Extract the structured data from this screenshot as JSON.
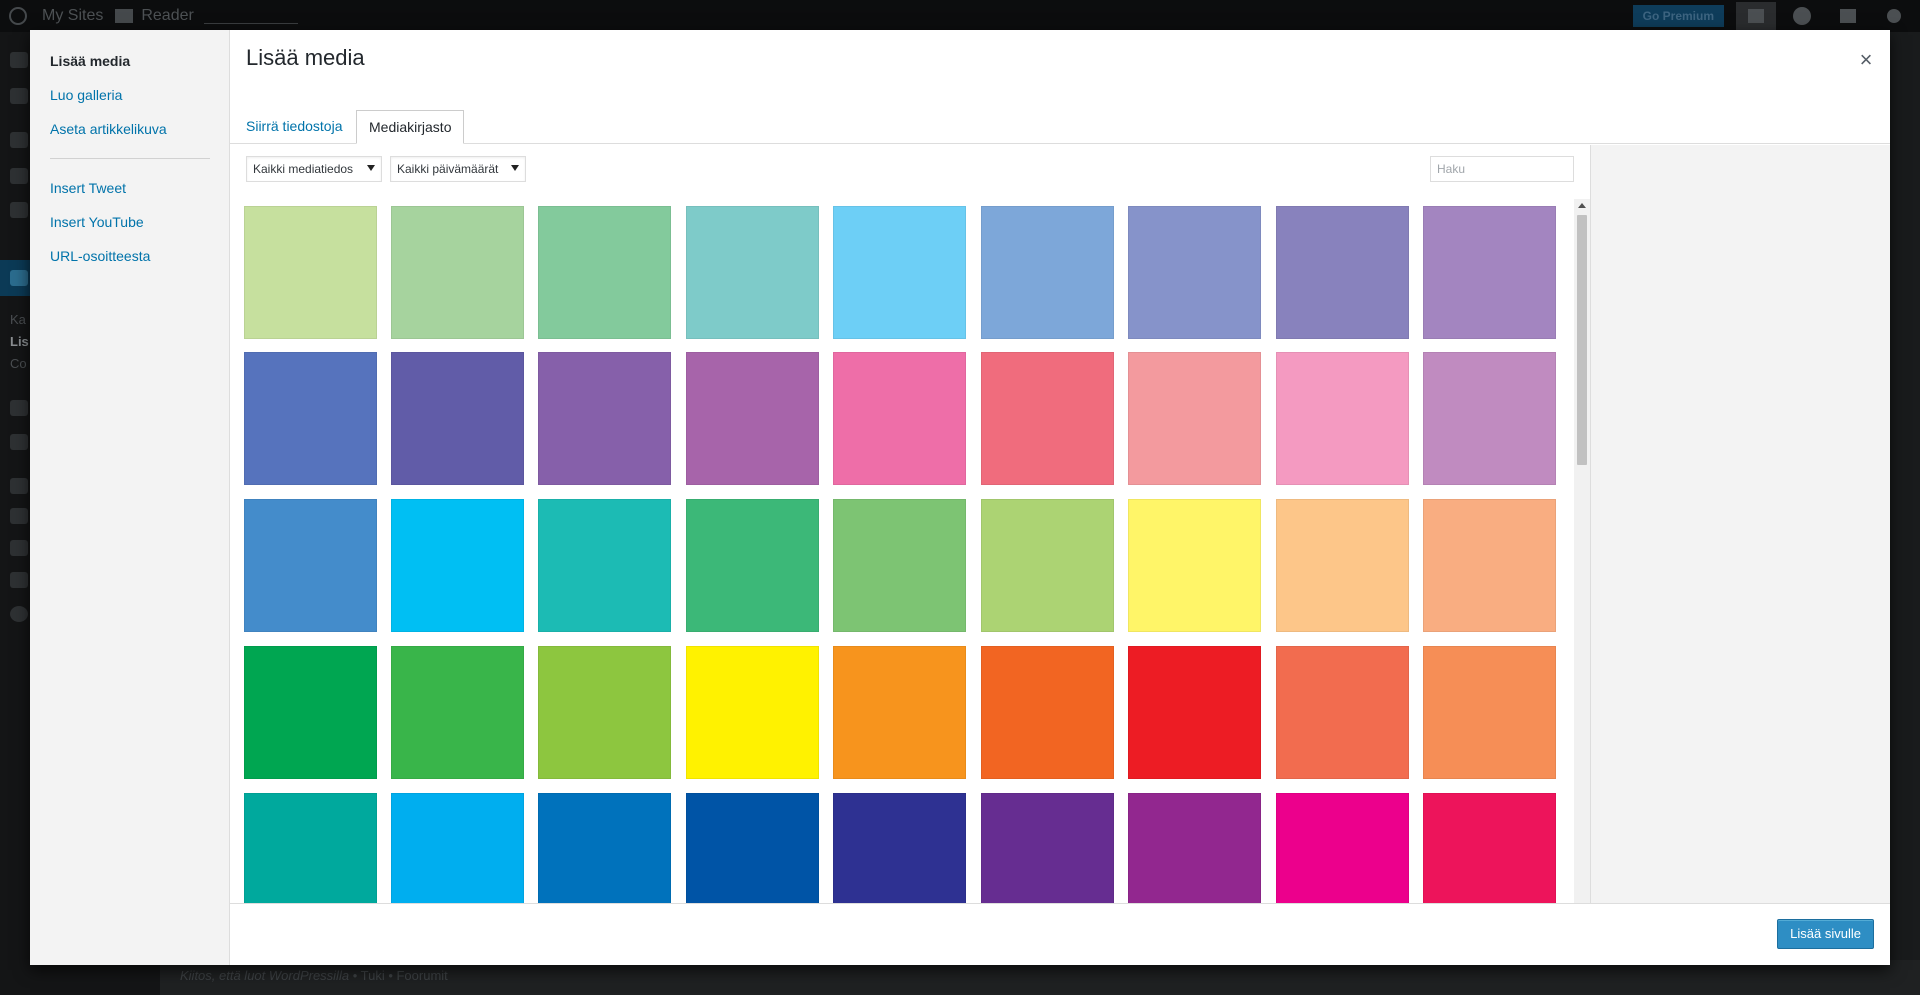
{
  "admin_bar": {
    "my_sites": "My Sites",
    "reader": "Reader",
    "go_premium": "Go Premium"
  },
  "admin_menu": {
    "sub_items": [
      "Ka",
      "Lis",
      "Co"
    ]
  },
  "backdrop_footer": {
    "thanks": "Kiitos, että luot WordPressilla",
    "links": "• Tuki • Foorumit"
  },
  "modal": {
    "title": "Lisää media",
    "close_glyph": "×",
    "menu": {
      "items": [
        "Lisää media",
        "Luo galleria",
        "Aseta artikkelikuva"
      ],
      "extra_items": [
        "Insert Tweet",
        "Insert YouTube",
        "URL-osoitteesta"
      ]
    },
    "tabs": {
      "upload": "Siirrä tiedostoja",
      "library": "Mediakirjasto"
    },
    "filters": {
      "type": "Kaikki mediatiedos",
      "date": "Kaikki päivämäärät"
    },
    "search_placeholder": "Haku",
    "insert_button": "Lisää sivulle"
  },
  "colors": {
    "accent": "#0073aa",
    "button": "#2e8ec4"
  },
  "icons": [
    "wordpress-logo-icon",
    "reader-icon",
    "new-post-icon",
    "globe-icon",
    "notifications-icon",
    "search-icon",
    "close-icon",
    "dropdown-arrow-icon"
  ],
  "attachments": [
    [
      "#c6e09e",
      "#a6d39e",
      "#83ca9c",
      "#7ecbc9",
      "#6dcff6",
      "#7da7d9",
      "#8693ca",
      "#8882bd",
      "#a385c0"
    ],
    [
      "#5673bd",
      "#615ca8",
      "#8660aa",
      "#a764aa",
      "#ee6ea8",
      "#f06c7d",
      "#f39a9e",
      "#f49ac1",
      "#c08bc0"
    ],
    [
      "#448ccb",
      "#00bff3",
      "#1cbbb4",
      "#3cb878",
      "#7dc473",
      "#acd373",
      "#fff568",
      "#fdc689",
      "#f9ad81"
    ],
    [
      "#00a651",
      "#39b54a",
      "#8dc63f",
      "#fff200",
      "#f7941d",
      "#f26522",
      "#ed1c24",
      "#f26c4f",
      "#f68e56"
    ],
    [
      "#00a99d",
      "#00aeef",
      "#0072bc",
      "#0054a6",
      "#2e3192",
      "#662d91",
      "#92278f",
      "#ec008c",
      "#ed145b"
    ]
  ]
}
